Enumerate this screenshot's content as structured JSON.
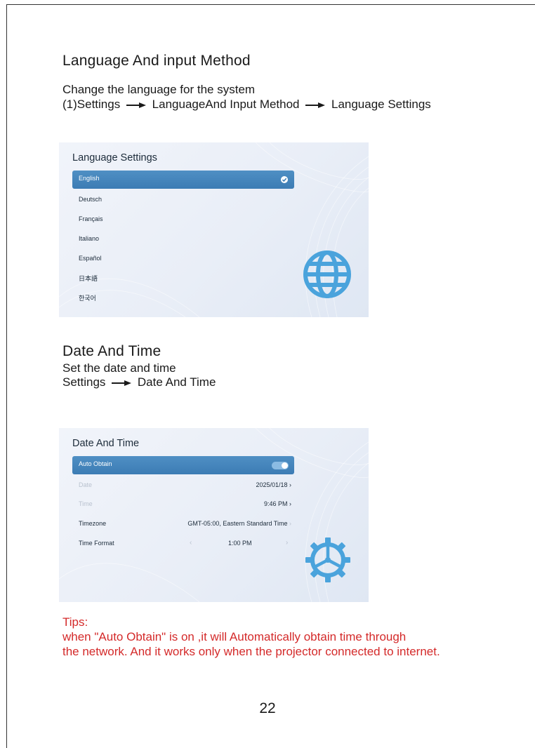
{
  "language_section": {
    "heading": "Language And input Method",
    "description": "Change the language for the system",
    "path_prefix": "(1)Settings",
    "path_step2": "LanguageAnd Input Method",
    "path_step3": "Language Settings"
  },
  "language_screen": {
    "title": "Language Settings",
    "selected": "English",
    "options": [
      "Deutsch",
      "Français",
      "Italiano",
      "Español",
      "日本語",
      "한국어"
    ],
    "icon": "globe-icon"
  },
  "datetime_section": {
    "heading": "Date And Time",
    "description": "Set the date and time",
    "path_step1": "Settings",
    "path_step2": "Date And Time"
  },
  "datetime_screen": {
    "title": "Date And Time",
    "auto_obtain_label": "Auto Obtain",
    "auto_obtain_on": true,
    "date_label": "Date",
    "date_value": "2025/01/18",
    "time_label": "Time",
    "time_value": "9:46 PM",
    "timezone_label": "Timezone",
    "timezone_value": "GMT-05:00, Eastern Standard Time",
    "timeformat_label": "Time Format",
    "timeformat_value": "1:00 PM",
    "icon": "gear-icon"
  },
  "tips": {
    "title": "Tips:",
    "line1": "when \"Auto Obtain\" is on ,it will Automatically obtain time through",
    "line2": "the network. And it works only when the projector connected to internet."
  },
  "page_number": "22",
  "colors": {
    "accent_blue": "#3f7fb6",
    "icon_blue": "#4aa3dc",
    "tips_red": "#d42a2a"
  }
}
